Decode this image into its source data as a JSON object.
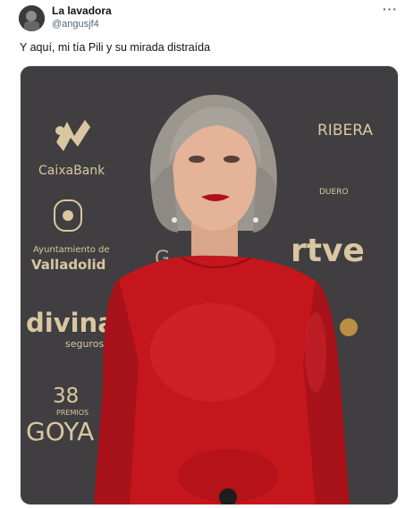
{
  "tweet": {
    "author_name": "La lavadora",
    "author_handle": "@angusjf4",
    "more_label": "···",
    "text": "Y aquí, mi tía Pili y su mirada distraída"
  },
  "media": {
    "backdrop_logos": [
      "CaixaBank",
      "Ayuntamiento de",
      "Valladolid",
      "RIBERA",
      "DUERO",
      "rtve",
      "divina",
      "seguros",
      "38",
      "PREMIOS",
      "GOYA"
    ],
    "colors": {
      "backdrop": "#3d3b3e",
      "logo_gold": "#d8c7a0",
      "dress_red": "#c4161c",
      "hair_gray": "#9b978f"
    }
  }
}
